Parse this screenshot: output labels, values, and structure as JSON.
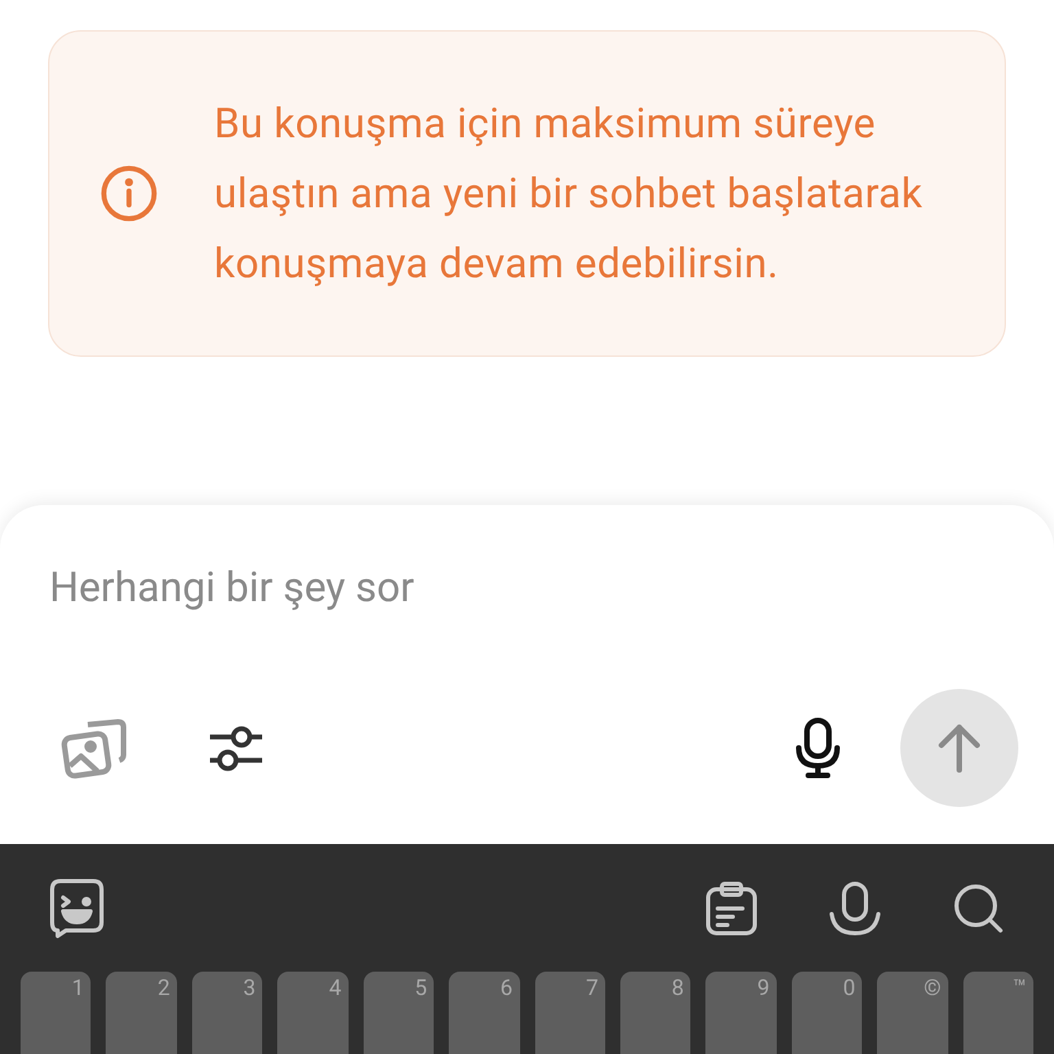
{
  "notice": {
    "text": "Bu konuşma için maksimum süreye ulaştın ama yeni bir sohbet başlatarak konuşmaya devam edebilirsin."
  },
  "composer": {
    "placeholder": "Herhangi bir şey sor"
  },
  "keyboard": {
    "keys": [
      {
        "hint": "1"
      },
      {
        "hint": "2"
      },
      {
        "hint": "3"
      },
      {
        "hint": "4"
      },
      {
        "hint": "5"
      },
      {
        "hint": "6"
      },
      {
        "hint": "7"
      },
      {
        "hint": "8"
      },
      {
        "hint": "9"
      },
      {
        "hint": "0"
      },
      {
        "hint": "©"
      },
      {
        "hint": "™"
      }
    ]
  }
}
